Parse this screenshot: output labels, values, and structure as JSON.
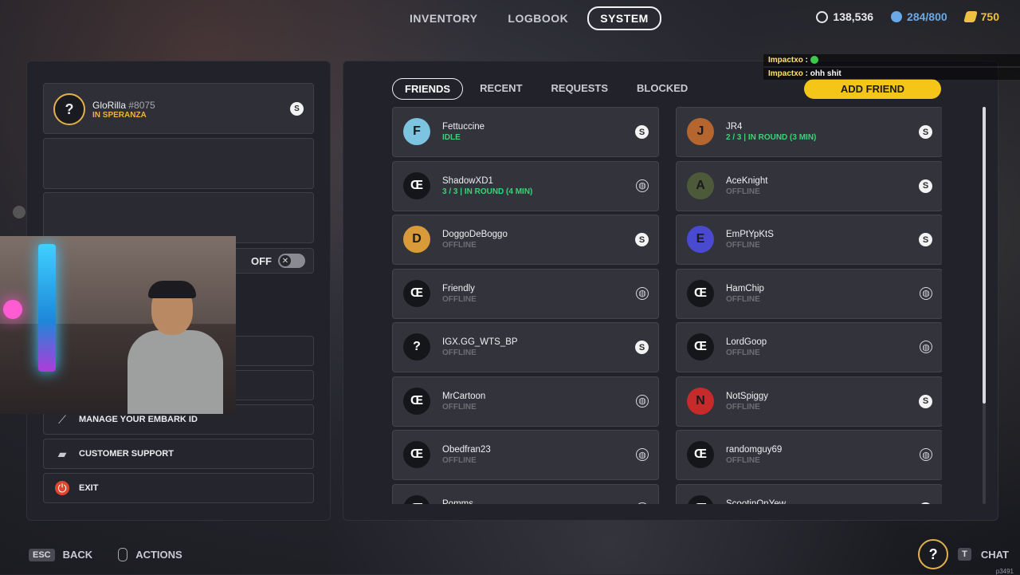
{
  "nav": {
    "tabs": [
      "INVENTORY",
      "LOGBOOK",
      "SYSTEM"
    ],
    "active": "SYSTEM"
  },
  "currency": [
    {
      "name": "coins",
      "value": "138,536",
      "color": "#e8e8ec"
    },
    {
      "name": "tokens",
      "value": "284/800",
      "color": "#6aa9e8"
    },
    {
      "name": "multibucks",
      "value": "750",
      "color": "#f0c040"
    }
  ],
  "profile": {
    "name": "GloRilla",
    "tag": "#8075",
    "status": "IN SPERANZA",
    "avatar_glyph": "?"
  },
  "toggle": {
    "label": "OFF"
  },
  "menu": {
    "manage": "MANAGE YOUR EMBARK ID",
    "support": "CUSTOMER SUPPORT",
    "exit": "EXIT"
  },
  "friends_tabs": {
    "friends": "FRIENDS",
    "recent": "RECENT",
    "requests": "REQUESTS",
    "blocked": "BLOCKED"
  },
  "add_friend": "ADD FRIEND",
  "friends": [
    {
      "name": "Fettuccine",
      "status": "IDLE",
      "green": true,
      "platform": "steam",
      "avatar": "F",
      "avatar_color": "#7cc4e0"
    },
    {
      "name": "JR4",
      "status": "2 / 3 | IN ROUND (3 MIN)",
      "green": true,
      "platform": "steam",
      "avatar": "J",
      "avatar_color": "#b5652e"
    },
    {
      "name": "ShadowXD1",
      "status": "3 / 3 | IN ROUND (4 MIN)",
      "green": true,
      "platform": "globe",
      "avatar": "Œ",
      "avatar_color": "#15161a"
    },
    {
      "name": "AceKnight",
      "status": "OFFLINE",
      "green": false,
      "platform": "steam",
      "avatar": "A",
      "avatar_color": "#4d5a3a"
    },
    {
      "name": "DoggoDeBoggo",
      "status": "OFFLINE",
      "green": false,
      "platform": "steam",
      "avatar": "D",
      "avatar_color": "#d99a3a"
    },
    {
      "name": "EmPtYpKtS",
      "status": "OFFLINE",
      "green": false,
      "platform": "steam",
      "avatar": "E",
      "avatar_color": "#4a4ad0"
    },
    {
      "name": "Friendly",
      "status": "OFFLINE",
      "green": false,
      "platform": "globe",
      "avatar": "Œ",
      "avatar_color": "#15161a"
    },
    {
      "name": "HamChip",
      "status": "OFFLINE",
      "green": false,
      "platform": "globe",
      "avatar": "Œ",
      "avatar_color": "#15161a"
    },
    {
      "name": "IGX.GG_WTS_BP",
      "status": "OFFLINE",
      "green": false,
      "platform": "steam",
      "avatar": "?",
      "avatar_color": "#15161a"
    },
    {
      "name": "LordGoop",
      "status": "OFFLINE",
      "green": false,
      "platform": "globe",
      "avatar": "Œ",
      "avatar_color": "#15161a"
    },
    {
      "name": "MrCartoon",
      "status": "OFFLINE",
      "green": false,
      "platform": "globe",
      "avatar": "Œ",
      "avatar_color": "#15161a"
    },
    {
      "name": "NotSpiggy",
      "status": "OFFLINE",
      "green": false,
      "platform": "steam",
      "avatar": "N",
      "avatar_color": "#c62a2a"
    },
    {
      "name": "Obedfran23",
      "status": "OFFLINE",
      "green": false,
      "platform": "globe",
      "avatar": "Œ",
      "avatar_color": "#15161a"
    },
    {
      "name": "randomguy69",
      "status": "OFFLINE",
      "green": false,
      "platform": "globe",
      "avatar": "Œ",
      "avatar_color": "#15161a"
    },
    {
      "name": "Pomms",
      "status": "",
      "green": false,
      "platform": "globe",
      "avatar": "Œ",
      "avatar_color": "#15161a"
    },
    {
      "name": "ScootinOnYew",
      "status": "",
      "green": false,
      "platform": "steam",
      "avatar": "Œ",
      "avatar_color": "#15161a"
    }
  ],
  "chat": [
    {
      "user": "Impactxo",
      "text": ""
    },
    {
      "user": "Impactxo",
      "text": "ohh shit"
    }
  ],
  "bottom": {
    "esc_key": "ESC",
    "back": "BACK",
    "actions": "ACTIONS",
    "chat_key": "T",
    "chat": "CHAT",
    "version": "p3491"
  }
}
